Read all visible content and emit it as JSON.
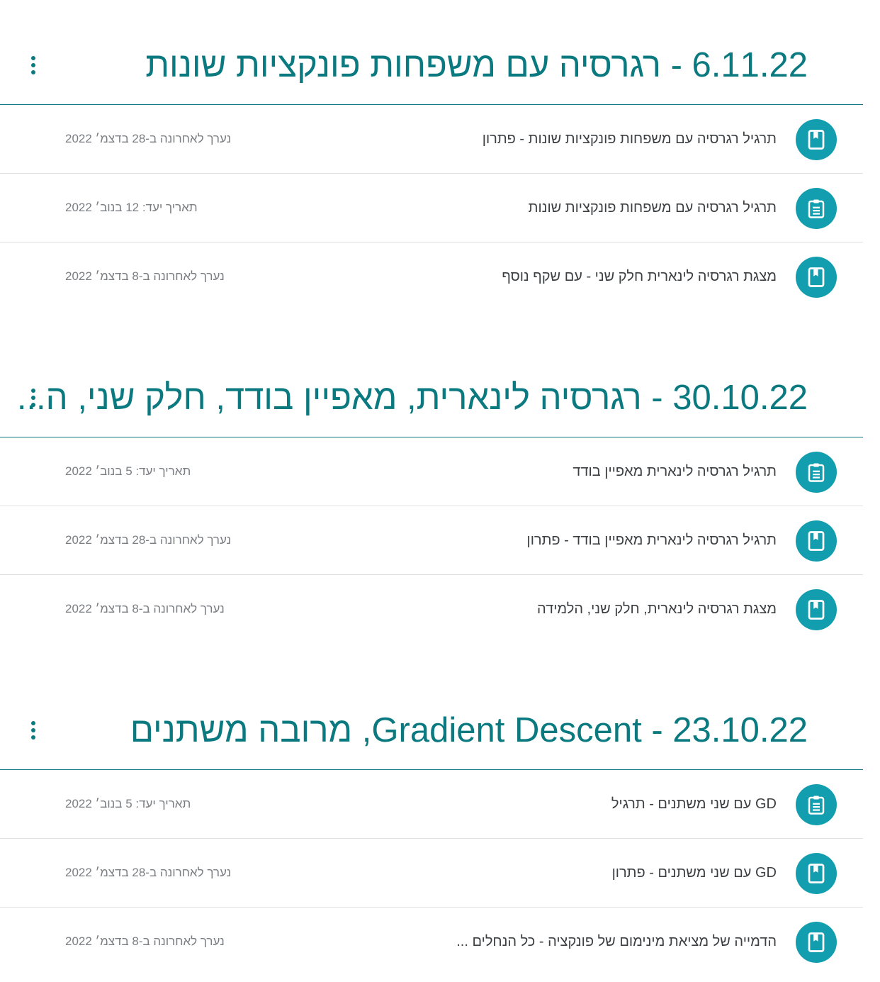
{
  "colors": {
    "accent": "#0b7a80",
    "icon_bg": "#129eaf",
    "divider": "#e0e0e0",
    "text": "#3c4043",
    "meta": "#7a7d81"
  },
  "topics": [
    {
      "title": "6.11.22 - רגרסיה עם משפחות פונקציות שונות",
      "menu_icon": "more-vert-icon",
      "items": [
        {
          "icon": "material-icon",
          "title": "תרגיל רגרסיה עם משפחות פונקציות שונות - פתרון",
          "meta": "נערך לאחרונה ב-28 בדצמ׳ 2022"
        },
        {
          "icon": "assignment-icon",
          "title": "תרגיל רגרסיה עם משפחות פונקציות שונות",
          "meta": "תאריך יעד: 12 בנוב׳ 2022"
        },
        {
          "icon": "material-icon",
          "title": "מצגת רגרסיה לינארית חלק שני - עם שקף נוסף",
          "meta": "נערך לאחרונה ב-8 בדצמ׳ 2022"
        }
      ]
    },
    {
      "title": "30.10.22 - רגרסיה לינארית, מאפיין בודד, חלק שני, ה...",
      "menu_icon": "more-vert-icon",
      "items": [
        {
          "icon": "assignment-icon",
          "title": "תרגיל רגרסיה לינארית מאפיין בודד",
          "meta": "תאריך יעד: 5 בנוב׳ 2022"
        },
        {
          "icon": "material-icon",
          "title": "תרגיל רגרסיה לינארית מאפיין בודד - פתרון",
          "meta": "נערך לאחרונה ב-28 בדצמ׳ 2022"
        },
        {
          "icon": "material-icon",
          "title": "מצגת רגרסיה לינארית, חלק שני, הלמידה",
          "meta": "נערך לאחרונה ב-8 בדצמ׳ 2022"
        }
      ]
    },
    {
      "title": "23.10.22 - Gradient Descent, מרובה משתנים",
      "menu_icon": "more-vert-icon",
      "items": [
        {
          "icon": "assignment-icon",
          "title": "GD עם שני משתנים - תרגיל",
          "meta": "תאריך יעד: 5 בנוב׳ 2022"
        },
        {
          "icon": "material-icon",
          "title": "GD עם שני משתנים - פתרון",
          "meta": "נערך לאחרונה ב-28 בדצמ׳ 2022"
        },
        {
          "icon": "material-icon",
          "title": "הדמייה של מציאת מינימום של פונקציה - כל הנחלים ...",
          "meta": "נערך לאחרונה ב-8 בדצמ׳ 2022"
        }
      ]
    }
  ]
}
